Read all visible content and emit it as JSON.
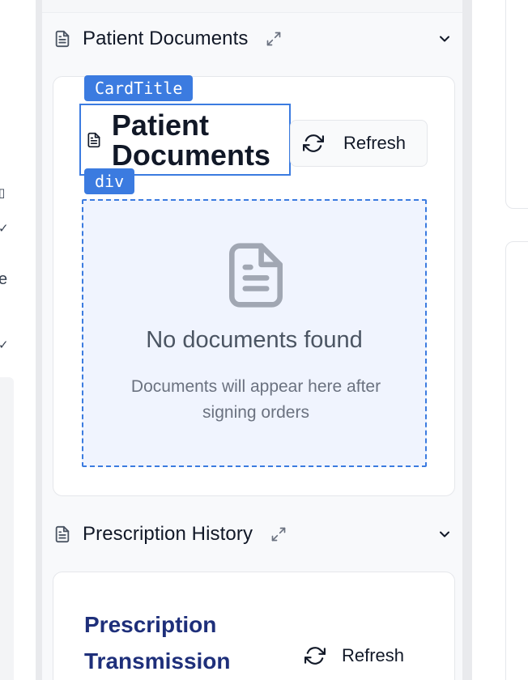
{
  "left_panel": {
    "glyphs": [
      "▯",
      "✓",
      "e",
      "✓"
    ]
  },
  "sections": {
    "documents": {
      "header_title": "Patient Documents",
      "card": {
        "title": "Patient Documents",
        "refresh_label": "Refresh",
        "empty_title": "No documents found",
        "empty_subtitle": "Documents will appear here after signing orders"
      }
    },
    "prescriptions": {
      "header_title": "Prescription History",
      "card": {
        "title": "Prescription Transmission",
        "refresh_label": "Refresh"
      }
    }
  },
  "debug_tags": {
    "card_title": "CardTitle",
    "div": "div"
  },
  "icons": {
    "doc": "file-text-icon",
    "expand": "expand-arrows-icon",
    "chevron": "chevron-down-icon",
    "refresh": "refresh-icon"
  },
  "colors": {
    "accent": "#3b7be0",
    "empty_bg": "#f0f4fe",
    "rx_title": "#1e2f7a"
  }
}
